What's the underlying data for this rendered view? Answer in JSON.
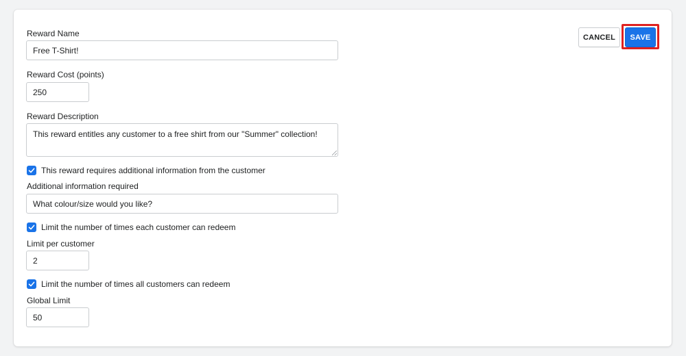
{
  "form": {
    "reward_name": {
      "label": "Reward Name",
      "value": "Free T-Shirt!"
    },
    "reward_cost": {
      "label": "Reward Cost (points)",
      "value": "250"
    },
    "reward_description": {
      "label": "Reward Description",
      "value": "This reward entitles any customer to a free shirt from our \"Summer\" collection!"
    },
    "requires_info": {
      "label": "This reward requires additional information from the customer",
      "checked": true
    },
    "additional_info": {
      "label": "Additional information required",
      "value": "What colour/size would you like?"
    },
    "limit_per_customer_toggle": {
      "label": "Limit the number of times each customer can redeem",
      "checked": true
    },
    "limit_per_customer": {
      "label": "Limit per customer",
      "value": "2"
    },
    "global_limit_toggle": {
      "label": "Limit the number of times all customers can redeem",
      "checked": true
    },
    "global_limit": {
      "label": "Global Limit",
      "value": "50"
    }
  },
  "actions": {
    "cancel_label": "CANCEL",
    "save_label": "SAVE"
  },
  "colors": {
    "accent": "#1a73e8",
    "highlight": "#e0211f"
  }
}
